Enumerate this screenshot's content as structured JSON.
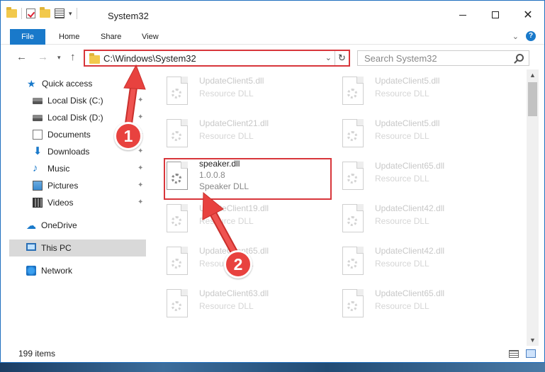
{
  "window": {
    "title": "System32",
    "controls": {
      "minimize": "minimize",
      "maximize": "maximize",
      "close": "✕"
    }
  },
  "ribbon": {
    "tabs": [
      {
        "label": "File"
      },
      {
        "label": "Home"
      },
      {
        "label": "Share"
      },
      {
        "label": "View"
      }
    ]
  },
  "address": {
    "path": "C:\\Windows\\System32",
    "search_placeholder": "Search System32"
  },
  "sidebar": {
    "items": [
      {
        "label": "Quick access",
        "icon": "star-icon"
      },
      {
        "label": "Local Disk (C:)",
        "icon": "drive-icon",
        "pinned": true
      },
      {
        "label": "Local Disk (D:)",
        "icon": "drive-icon",
        "pinned": true
      },
      {
        "label": "Documents",
        "icon": "document-icon",
        "pinned": true
      },
      {
        "label": "Downloads",
        "icon": "download-icon",
        "pinned": true
      },
      {
        "label": "Music",
        "icon": "music-icon",
        "pinned": true
      },
      {
        "label": "Pictures",
        "icon": "pictures-icon",
        "pinned": true
      },
      {
        "label": "Videos",
        "icon": "videos-icon",
        "pinned": true
      },
      {
        "label": "OneDrive",
        "icon": "cloud-icon"
      },
      {
        "label": "This PC",
        "icon": "computer-icon",
        "selected": true
      },
      {
        "label": "Network",
        "icon": "network-icon"
      }
    ]
  },
  "files": {
    "left": [
      {
        "name": "UpdateClient5.dll",
        "desc": "Resource DLL"
      },
      {
        "name": "UpdateClient21.dll",
        "desc": "Resource DLL"
      },
      {
        "name": "speaker.dll",
        "version": "1.0.0.8",
        "desc": "Speaker DLL",
        "active": true
      },
      {
        "name": "UpdateClient19.dll",
        "desc": "Resource DLL"
      },
      {
        "name": "UpdateClient65.dll",
        "desc": "Resource DLL"
      },
      {
        "name": "UpdateClient63.dll",
        "desc": "Resource DLL"
      }
    ],
    "right": [
      {
        "name": "UpdateClient5.dll",
        "desc": "Resource DLL"
      },
      {
        "name": "UpdateClient5.dll",
        "desc": "Resource DLL"
      },
      {
        "name": "UpdateClient65.dll",
        "desc": "Resource DLL"
      },
      {
        "name": "UpdateClient42.dll",
        "desc": "Resource DLL"
      },
      {
        "name": "UpdateClient42.dll",
        "desc": "Resource DLL"
      },
      {
        "name": "UpdateClient65.dll",
        "desc": "Resource DLL"
      }
    ]
  },
  "status": {
    "item_count": "199 items"
  },
  "annotations": {
    "step1": "1",
    "step2": "2",
    "highlight_color": "#d8363b",
    "badge_color": "#e8423f"
  }
}
